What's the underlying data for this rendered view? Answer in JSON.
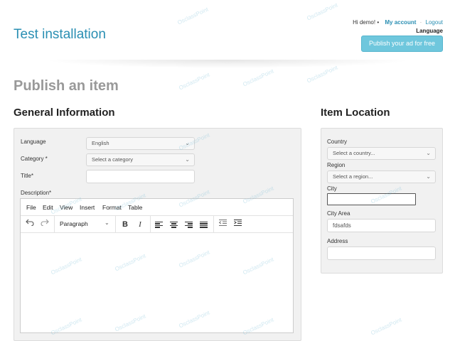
{
  "header": {
    "site_title": "Test installation",
    "greeting": "Hi demo!",
    "bullet": "•",
    "my_account": "My account",
    "dot": "·",
    "logout": "Logout",
    "language": "Language",
    "publish_button": "Publish your ad for free"
  },
  "page": {
    "title": "Publish an item"
  },
  "general": {
    "title": "General Information",
    "language_label": "Language",
    "language_value": "English",
    "category_label": "Category *",
    "category_value": "Select a category",
    "title_label": "Title*",
    "title_value": "",
    "description_label": "Description*"
  },
  "editor": {
    "menu": [
      "File",
      "Edit",
      "View",
      "Insert",
      "Format",
      "Table"
    ],
    "block_format": "Paragraph"
  },
  "location": {
    "title": "Item Location",
    "country_label": "Country",
    "country_value": "Select a country...",
    "region_label": "Region",
    "region_value": "Select a region...",
    "city_label": "City",
    "city_value": "",
    "city_area_label": "City Area",
    "city_area_value": "fdsafds",
    "address_label": "Address",
    "address_value": ""
  },
  "watermark": "OsclassPoint",
  "colors": {
    "brand": "#2a8fb3",
    "publish_button": "#6fc7dd",
    "panel": "#f1f1f1"
  }
}
